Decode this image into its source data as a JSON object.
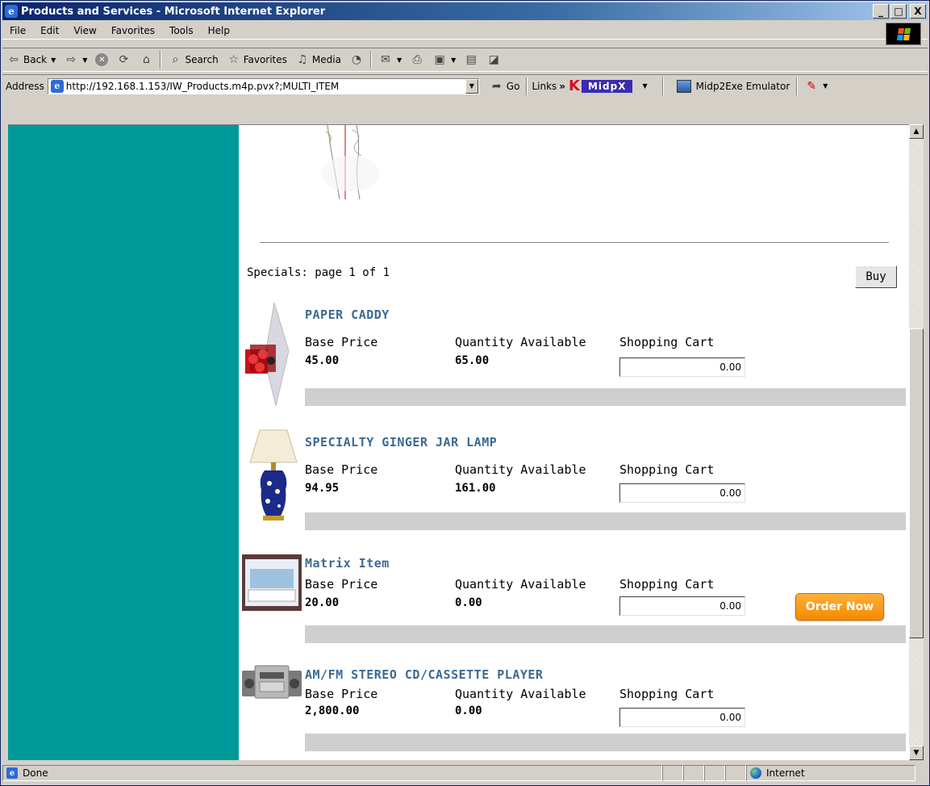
{
  "window": {
    "title": "Products and Services - Microsoft Internet Explorer",
    "controls": {
      "minimize": "_",
      "maximize": "□",
      "close": "X"
    }
  },
  "menubar": {
    "items": [
      {
        "label": "File"
      },
      {
        "label": "Edit"
      },
      {
        "label": "View"
      },
      {
        "label": "Favorites"
      },
      {
        "label": "Tools"
      },
      {
        "label": "Help"
      }
    ]
  },
  "toolbar": {
    "back": "Back",
    "search": "Search",
    "favorites": "Favorites",
    "media": "Media"
  },
  "addressbar": {
    "label": "Address",
    "url": "http://192.168.1.153/IW_Products.m4p.pvx?;MULTI_ITEM",
    "go": "Go",
    "links": "Links",
    "links_chevron": "»",
    "midpx_brand": "MidpX",
    "emulator": "Midp2Exe Emulator"
  },
  "page": {
    "specials_label": "Specials: page 1 of 1",
    "buy_label": "Buy",
    "col_base_price": "Base Price",
    "col_quantity": "Quantity Available",
    "col_cart": "Shopping Cart",
    "order_now_label": "Order Now",
    "products": [
      {
        "name": "PAPER CADDY",
        "base_price": "45.00",
        "quantity": "65.00",
        "cart": "0.00"
      },
      {
        "name": "SPECIALTY GINGER JAR LAMP",
        "base_price": "94.95",
        "quantity": "161.00",
        "cart": "0.00"
      },
      {
        "name": "Matrix Item",
        "base_price": "20.00",
        "quantity": "0.00",
        "cart": "0.00"
      },
      {
        "name": "AM/FM STEREO CD/CASSETTE PLAYER",
        "base_price": "2,800.00",
        "quantity": "0.00",
        "cart": "0.00"
      }
    ]
  },
  "statusbar": {
    "status": "Done",
    "zone": "Internet"
  },
  "colors": {
    "left_band": "#009999",
    "product_name": "#3b6a94",
    "order_now": "#f58a00",
    "row_bar": "#cfcfcf"
  }
}
